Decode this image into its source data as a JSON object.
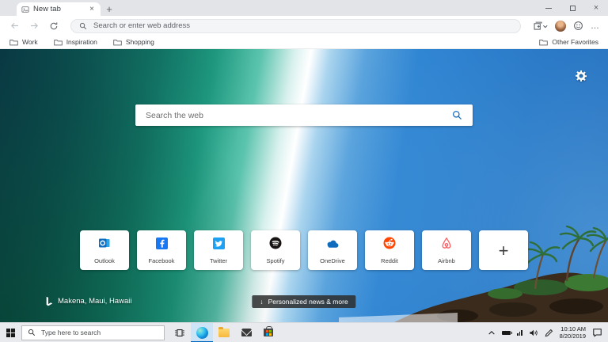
{
  "window": {
    "tab_title": "New tab"
  },
  "toolbar": {
    "address_placeholder": "Search or enter web address"
  },
  "favorites_bar": {
    "items": [
      "Work",
      "Inspiration",
      "Shopping"
    ],
    "other_favorites": "Other Favorites"
  },
  "newtab": {
    "search_placeholder": "Search the web",
    "tiles": [
      {
        "name": "Outlook"
      },
      {
        "name": "Facebook"
      },
      {
        "name": "Twitter"
      },
      {
        "name": "Spotify"
      },
      {
        "name": "OneDrive"
      },
      {
        "name": "Reddit"
      },
      {
        "name": "Airbnb"
      },
      {
        "name": ""
      }
    ],
    "location_label": "Makena, Maui, Hawaii",
    "news_button_label": "Personalized news & more"
  },
  "taskbar": {
    "search_placeholder": "Type here to search",
    "time": "10:10 AM",
    "date": "8/20/2019"
  },
  "icons": {
    "close": "×",
    "plus": "+",
    "minimize": "–",
    "ellipsis": "…",
    "down_arrow": "↓"
  },
  "colors": {
    "accent_blue": "#0067c0",
    "edge_blue": "#0b63b8",
    "outlook": "#0f6cbd",
    "facebook": "#1877f2",
    "twitter": "#1da1f2",
    "spotify": "#191414",
    "onedrive": "#0f6cbd",
    "reddit": "#ff4500",
    "airbnb": "#ff5a5f"
  }
}
